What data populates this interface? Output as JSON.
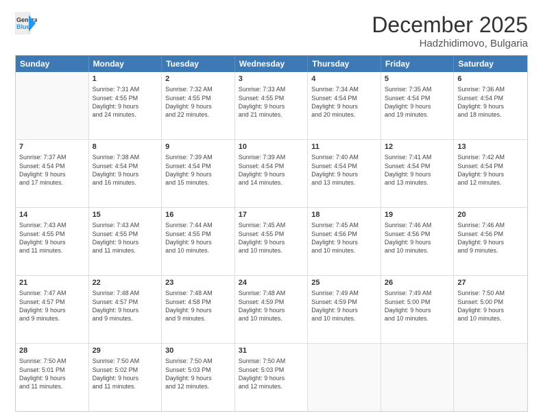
{
  "header": {
    "logo_general": "General",
    "logo_blue": "Blue",
    "month_year": "December 2025",
    "location": "Hadzhidimovo, Bulgaria"
  },
  "days_of_week": [
    "Sunday",
    "Monday",
    "Tuesday",
    "Wednesday",
    "Thursday",
    "Friday",
    "Saturday"
  ],
  "weeks": [
    [
      {
        "num": "",
        "lines": []
      },
      {
        "num": "1",
        "lines": [
          "Sunrise: 7:31 AM",
          "Sunset: 4:55 PM",
          "Daylight: 9 hours",
          "and 24 minutes."
        ]
      },
      {
        "num": "2",
        "lines": [
          "Sunrise: 7:32 AM",
          "Sunset: 4:55 PM",
          "Daylight: 9 hours",
          "and 22 minutes."
        ]
      },
      {
        "num": "3",
        "lines": [
          "Sunrise: 7:33 AM",
          "Sunset: 4:55 PM",
          "Daylight: 9 hours",
          "and 21 minutes."
        ]
      },
      {
        "num": "4",
        "lines": [
          "Sunrise: 7:34 AM",
          "Sunset: 4:54 PM",
          "Daylight: 9 hours",
          "and 20 minutes."
        ]
      },
      {
        "num": "5",
        "lines": [
          "Sunrise: 7:35 AM",
          "Sunset: 4:54 PM",
          "Daylight: 9 hours",
          "and 19 minutes."
        ]
      },
      {
        "num": "6",
        "lines": [
          "Sunrise: 7:36 AM",
          "Sunset: 4:54 PM",
          "Daylight: 9 hours",
          "and 18 minutes."
        ]
      }
    ],
    [
      {
        "num": "7",
        "lines": [
          "Sunrise: 7:37 AM",
          "Sunset: 4:54 PM",
          "Daylight: 9 hours",
          "and 17 minutes."
        ]
      },
      {
        "num": "8",
        "lines": [
          "Sunrise: 7:38 AM",
          "Sunset: 4:54 PM",
          "Daylight: 9 hours",
          "and 16 minutes."
        ]
      },
      {
        "num": "9",
        "lines": [
          "Sunrise: 7:39 AM",
          "Sunset: 4:54 PM",
          "Daylight: 9 hours",
          "and 15 minutes."
        ]
      },
      {
        "num": "10",
        "lines": [
          "Sunrise: 7:39 AM",
          "Sunset: 4:54 PM",
          "Daylight: 9 hours",
          "and 14 minutes."
        ]
      },
      {
        "num": "11",
        "lines": [
          "Sunrise: 7:40 AM",
          "Sunset: 4:54 PM",
          "Daylight: 9 hours",
          "and 13 minutes."
        ]
      },
      {
        "num": "12",
        "lines": [
          "Sunrise: 7:41 AM",
          "Sunset: 4:54 PM",
          "Daylight: 9 hours",
          "and 13 minutes."
        ]
      },
      {
        "num": "13",
        "lines": [
          "Sunrise: 7:42 AM",
          "Sunset: 4:54 PM",
          "Daylight: 9 hours",
          "and 12 minutes."
        ]
      }
    ],
    [
      {
        "num": "14",
        "lines": [
          "Sunrise: 7:43 AM",
          "Sunset: 4:55 PM",
          "Daylight: 9 hours",
          "and 11 minutes."
        ]
      },
      {
        "num": "15",
        "lines": [
          "Sunrise: 7:43 AM",
          "Sunset: 4:55 PM",
          "Daylight: 9 hours",
          "and 11 minutes."
        ]
      },
      {
        "num": "16",
        "lines": [
          "Sunrise: 7:44 AM",
          "Sunset: 4:55 PM",
          "Daylight: 9 hours",
          "and 10 minutes."
        ]
      },
      {
        "num": "17",
        "lines": [
          "Sunrise: 7:45 AM",
          "Sunset: 4:55 PM",
          "Daylight: 9 hours",
          "and 10 minutes."
        ]
      },
      {
        "num": "18",
        "lines": [
          "Sunrise: 7:45 AM",
          "Sunset: 4:56 PM",
          "Daylight: 9 hours",
          "and 10 minutes."
        ]
      },
      {
        "num": "19",
        "lines": [
          "Sunrise: 7:46 AM",
          "Sunset: 4:56 PM",
          "Daylight: 9 hours",
          "and 10 minutes."
        ]
      },
      {
        "num": "20",
        "lines": [
          "Sunrise: 7:46 AM",
          "Sunset: 4:56 PM",
          "Daylight: 9 hours",
          "and 9 minutes."
        ]
      }
    ],
    [
      {
        "num": "21",
        "lines": [
          "Sunrise: 7:47 AM",
          "Sunset: 4:57 PM",
          "Daylight: 9 hours",
          "and 9 minutes."
        ]
      },
      {
        "num": "22",
        "lines": [
          "Sunrise: 7:48 AM",
          "Sunset: 4:57 PM",
          "Daylight: 9 hours",
          "and 9 minutes."
        ]
      },
      {
        "num": "23",
        "lines": [
          "Sunrise: 7:48 AM",
          "Sunset: 4:58 PM",
          "Daylight: 9 hours",
          "and 9 minutes."
        ]
      },
      {
        "num": "24",
        "lines": [
          "Sunrise: 7:48 AM",
          "Sunset: 4:59 PM",
          "Daylight: 9 hours",
          "and 10 minutes."
        ]
      },
      {
        "num": "25",
        "lines": [
          "Sunrise: 7:49 AM",
          "Sunset: 4:59 PM",
          "Daylight: 9 hours",
          "and 10 minutes."
        ]
      },
      {
        "num": "26",
        "lines": [
          "Sunrise: 7:49 AM",
          "Sunset: 5:00 PM",
          "Daylight: 9 hours",
          "and 10 minutes."
        ]
      },
      {
        "num": "27",
        "lines": [
          "Sunrise: 7:50 AM",
          "Sunset: 5:00 PM",
          "Daylight: 9 hours",
          "and 10 minutes."
        ]
      }
    ],
    [
      {
        "num": "28",
        "lines": [
          "Sunrise: 7:50 AM",
          "Sunset: 5:01 PM",
          "Daylight: 9 hours",
          "and 11 minutes."
        ]
      },
      {
        "num": "29",
        "lines": [
          "Sunrise: 7:50 AM",
          "Sunset: 5:02 PM",
          "Daylight: 9 hours",
          "and 11 minutes."
        ]
      },
      {
        "num": "30",
        "lines": [
          "Sunrise: 7:50 AM",
          "Sunset: 5:03 PM",
          "Daylight: 9 hours",
          "and 12 minutes."
        ]
      },
      {
        "num": "31",
        "lines": [
          "Sunrise: 7:50 AM",
          "Sunset: 5:03 PM",
          "Daylight: 9 hours",
          "and 12 minutes."
        ]
      },
      {
        "num": "",
        "lines": []
      },
      {
        "num": "",
        "lines": []
      },
      {
        "num": "",
        "lines": []
      }
    ]
  ]
}
